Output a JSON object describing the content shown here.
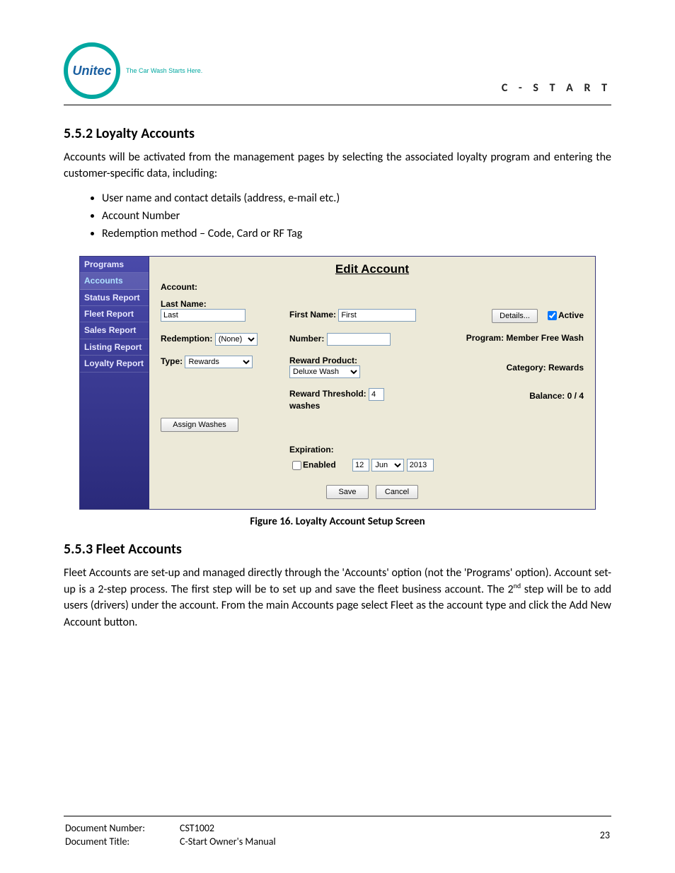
{
  "header": {
    "logo_text": "Unitec",
    "logo_tagline": "The Car Wash Starts Here.",
    "right_label": "C - S T A R T"
  },
  "section552": {
    "heading": "5.5.2  Loyalty Accounts",
    "para": "Accounts will be activated from the management pages by selecting the associated loyalty program and entering the customer-specific data, including:",
    "bullets": [
      "User name and contact details (address, e-mail etc.)",
      "Account Number",
      "Redemption method – Code, Card or RF Tag"
    ]
  },
  "app": {
    "sidenav": [
      {
        "label": "Programs",
        "selected": false
      },
      {
        "label": "Accounts",
        "selected": true
      },
      {
        "label": "Status Report",
        "selected": false
      },
      {
        "label": "Fleet Report",
        "selected": false
      },
      {
        "label": "Sales Report",
        "selected": false
      },
      {
        "label": "Listing Report",
        "selected": false
      },
      {
        "label": "Loyalty Report",
        "selected": false
      }
    ],
    "title": "Edit Account",
    "account_label": "Account:",
    "lastname_label": "Last Name:",
    "lastname_value": "Last",
    "firstname_label": "First Name:",
    "firstname_value": "First",
    "details_btn": "Details...",
    "active_label": "Active",
    "active_checked": true,
    "redemption_label": "Redemption:",
    "redemption_value": "(None)",
    "number_label": "Number:",
    "number_value": "",
    "program_label": "Program:",
    "program_value": "Member Free Wash",
    "type_label": "Type:",
    "type_value": "Rewards",
    "reward_product_label": "Reward Product:",
    "reward_product_value": "Deluxe Wash",
    "category_label": "Category:",
    "category_value": "Rewards",
    "reward_threshold_label": "Reward Threshold:",
    "reward_threshold_value": "4",
    "reward_threshold_unit": "washes",
    "balance_label": "Balance:",
    "balance_value": "0 / 4",
    "assign_washes_btn": "Assign Washes",
    "expiration_label": "Expiration:",
    "enabled_label": "Enabled",
    "enabled_checked": false,
    "exp_day": "12",
    "exp_month": "Jun",
    "exp_year": "2013",
    "save_btn": "Save",
    "cancel_btn": "Cancel"
  },
  "figure_caption": "Figure 16. Loyalty Account Setup Screen",
  "section553": {
    "heading": "5.5.3  Fleet Accounts",
    "para_before_sup": "Fleet Accounts are set-up and managed directly through the 'Accounts' option (not the 'Programs' option). Account set-up is a 2-step process. The first step will be to set up and save the fleet business account. The 2",
    "sup": "nd",
    "para_after_sup": " step will be to add users (drivers) under the account. From the main Accounts page select Fleet as the account type and click the Add New Account button."
  },
  "footer": {
    "docnum_label": "Document Number:",
    "docnum_value": "CST1002",
    "doctitle_label": "Document Title:",
    "doctitle_value": "C-Start Owner's Manual",
    "page_number": "23"
  }
}
